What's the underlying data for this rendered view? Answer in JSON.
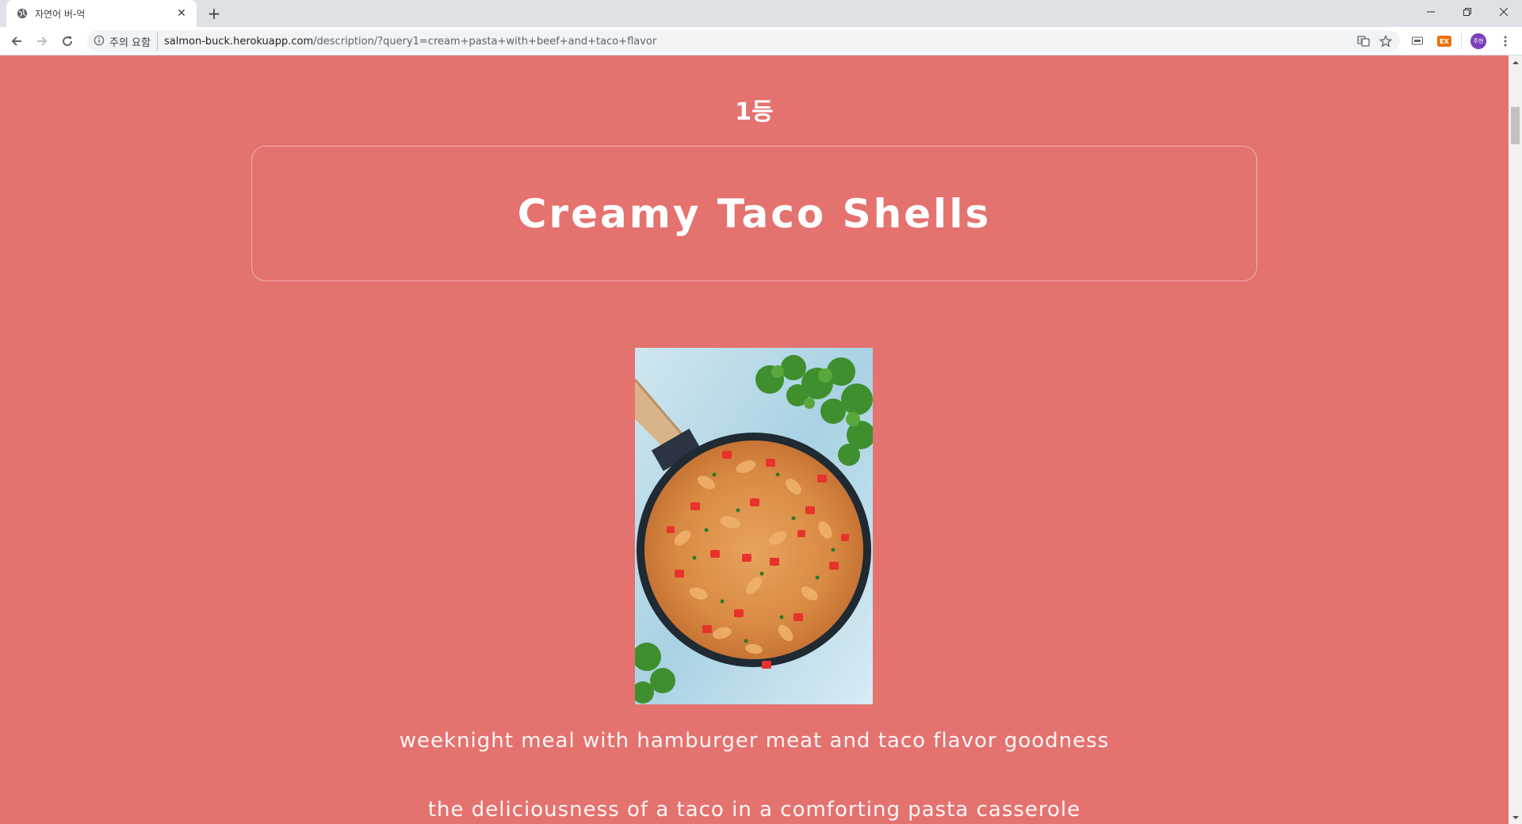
{
  "browser": {
    "tab_title": "자연어 버-억",
    "security_label": "주의 요함",
    "url_host": "salmon-buck.herokuapp.com",
    "url_path": "/description/?query1=cream+pasta+with+beef+and+taco+flavor",
    "extension_badge": "EX",
    "profile_initials": "주현"
  },
  "page": {
    "rank": "1등",
    "title": "Creamy Taco Shells",
    "descriptions": [
      "weeknight meal with hamburger meat and taco flavor goodness",
      "the deliciousness of a taco in a comforting pasta casserole"
    ],
    "image": "creamy-taco-shells-skillet",
    "background_color": "#e4726f"
  }
}
